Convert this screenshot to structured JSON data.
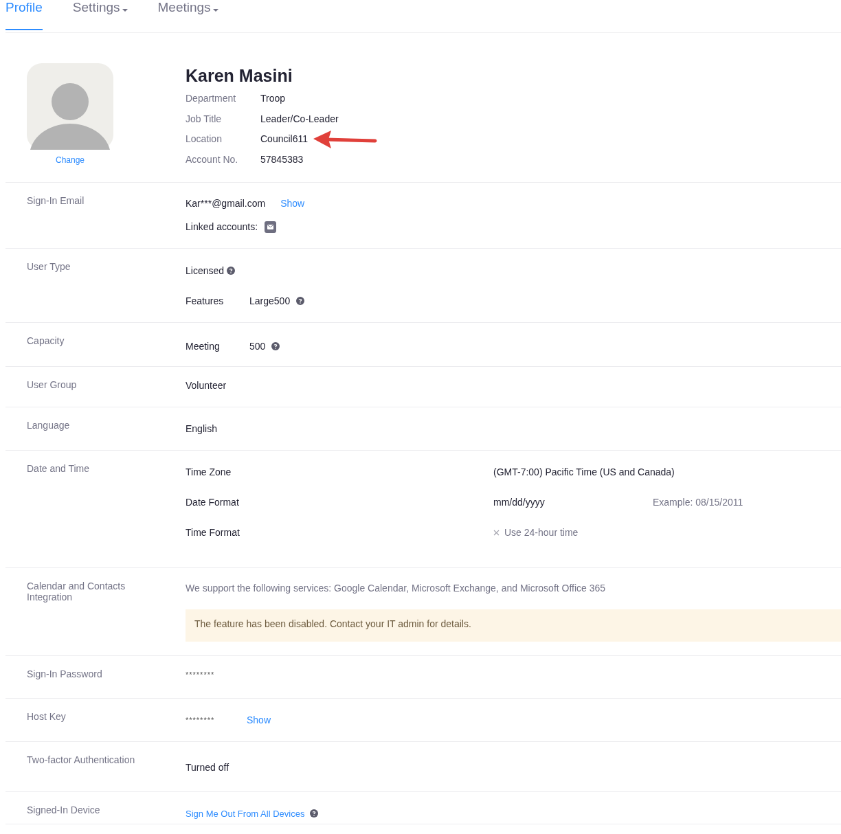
{
  "tabs": [
    {
      "label": "Profile",
      "selected": true,
      "dropdown": false
    },
    {
      "label": "Settings",
      "selected": false,
      "dropdown": true
    },
    {
      "label": "Meetings",
      "selected": false,
      "dropdown": true
    }
  ],
  "profile": {
    "change_link": "Change",
    "name": "Karen Masini",
    "fields": [
      {
        "label": "Department",
        "value": "Troop",
        "annotated": false
      },
      {
        "label": "Job Title",
        "value": "Leader/Co-Leader",
        "annotated": false
      },
      {
        "label": "Location",
        "value": "Council611",
        "annotated": true
      },
      {
        "label": "Account No.",
        "value": "57845383",
        "annotated": false
      }
    ]
  },
  "sections": [
    {
      "label": "Sign-In Email",
      "lines": [
        {
          "kind": "value",
          "text": "Kar***@gmail.com",
          "link": "Show"
        },
        {
          "kind": "linked",
          "text": "Linked accounts:"
        }
      ]
    },
    {
      "label": "User Type",
      "lines": [
        {
          "kind": "value",
          "text": "Licensed",
          "help": true
        },
        {
          "kind": "pair",
          "label": "Features",
          "value": "Large500",
          "help": true
        }
      ]
    },
    {
      "label": "Capacity",
      "lines": [
        {
          "kind": "pair",
          "label": "Meeting",
          "value": "500",
          "help": true
        }
      ]
    },
    {
      "label": "User Group",
      "lines": [
        {
          "kind": "value",
          "text": "Volunteer"
        }
      ]
    },
    {
      "label": "Language",
      "lines": [
        {
          "kind": "value",
          "text": "English"
        }
      ]
    },
    {
      "label": "Date and Time",
      "lines": [
        {
          "kind": "setting",
          "label": "Time Zone",
          "value": "(GMT-7:00) Pacific Time (US and Canada)"
        },
        {
          "kind": "setting",
          "label": "Date Format",
          "value": "mm/dd/yyyy",
          "note": "Example: 08/15/2011"
        },
        {
          "kind": "toggle",
          "label": "Time Format",
          "value": "Use 24-hour time",
          "checked": false
        }
      ]
    },
    {
      "label": "Calendar and Contacts Integration",
      "lines": [
        {
          "kind": "muted",
          "text": "We support the following services: Google Calendar, Microsoft Exchange, and Microsoft Office 365"
        },
        {
          "kind": "alert",
          "text": "The feature has been disabled. Contact your IT admin for details."
        }
      ]
    },
    {
      "label": "Sign-In Password",
      "lines": [
        {
          "kind": "masked",
          "text": "********"
        }
      ]
    },
    {
      "label": "Host Key",
      "lines": [
        {
          "kind": "masked",
          "text": "********",
          "link": "Show"
        }
      ]
    },
    {
      "label": "Two-factor Authentication",
      "lines": [
        {
          "kind": "value",
          "text": "Turned off"
        }
      ]
    },
    {
      "label": "Signed-In Device",
      "lines": [
        {
          "kind": "action",
          "text": "Sign Me Out From All Devices",
          "help": true
        }
      ]
    }
  ]
}
